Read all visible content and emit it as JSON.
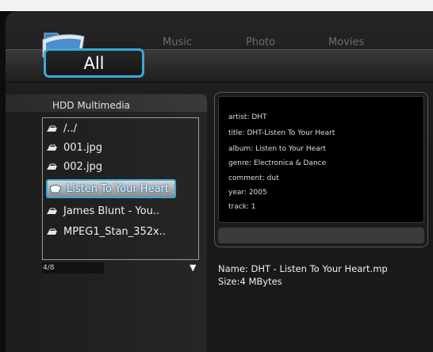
{
  "tabs": {
    "all": "All",
    "music": "Music",
    "photo": "Photo",
    "movies": "Movies"
  },
  "browser": {
    "source": "HDD Multimedia",
    "items": [
      {
        "label": "/../",
        "icon": "file-icon",
        "selected": false
      },
      {
        "label": "001.jpg",
        "icon": "file-icon",
        "selected": false
      },
      {
        "label": "002.jpg",
        "icon": "file-icon",
        "selected": false
      },
      {
        "label": "Listen To Your Heart",
        "icon": "music-note-icon",
        "selected": true
      },
      {
        "label": "James Blunt - You..",
        "icon": "file-icon",
        "selected": false
      },
      {
        "label": "MPEG1_Stan_352x..",
        "icon": "file-icon",
        "selected": false
      }
    ],
    "counter": "4/8",
    "scroll_icon": "down-arrow-icon"
  },
  "info": {
    "lines": [
      "artist: DHT",
      "title: DHT-Listen To Your Heart",
      "album: Listen to Your Heart",
      "genre: Electronica & Dance",
      "comment: dut",
      "year: 2005",
      "track: 1"
    ],
    "name": "Name: DHT - Listen To Your Heart.mp",
    "size": "Size:4 MBytes"
  },
  "colors": {
    "accent": "#3aa8d8",
    "background": "#181818"
  }
}
